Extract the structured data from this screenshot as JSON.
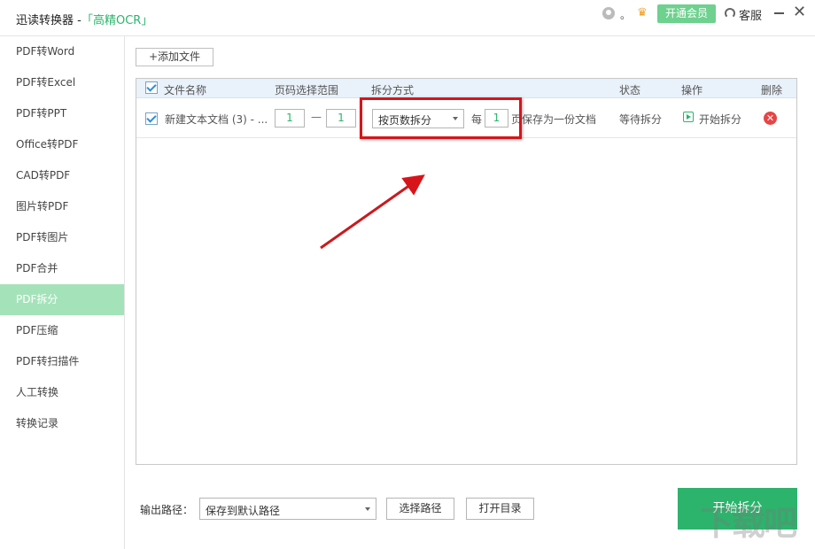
{
  "window": {
    "app_title": "迅读转换器 -",
    "ocr_link": "「高精OCR」",
    "user_name": "。",
    "vip_button": "开通会员",
    "service_label": "客服"
  },
  "sidebar": {
    "items": [
      {
        "label": "PDF转Word"
      },
      {
        "label": "PDF转Excel"
      },
      {
        "label": "PDF转PPT"
      },
      {
        "label": "Office转PDF"
      },
      {
        "label": "CAD转PDF"
      },
      {
        "label": "图片转PDF"
      },
      {
        "label": "PDF转图片"
      },
      {
        "label": "PDF合并"
      },
      {
        "label": "PDF拆分"
      },
      {
        "label": "PDF压缩"
      },
      {
        "label": "PDF转扫描件"
      },
      {
        "label": "人工转换"
      },
      {
        "label": "转换记录"
      }
    ],
    "active_index": 8
  },
  "toolbar": {
    "add_file": "+添加文件"
  },
  "table": {
    "headers": {
      "name": "文件名称",
      "page_range": "页码选择范围",
      "split_mode": "拆分方式",
      "status": "状态",
      "action": "操作",
      "delete": "删除"
    },
    "rows": [
      {
        "name": "新建文本文档 (3) - ...",
        "range_from": "1",
        "range_dash": "—",
        "range_to": "1",
        "split_mode": "按页数拆分",
        "every_label": "每",
        "pages_per": "1",
        "pages_suffix": "页保存为一份文档",
        "status": "等待拆分",
        "action": "开始拆分"
      }
    ]
  },
  "bottom": {
    "output_label": "输出路径：",
    "path_value": "保存到默认路径",
    "choose_path": "选择路径",
    "open_dir": "打开目录",
    "start_split": "开始拆分"
  },
  "watermark": "下载吧",
  "colors": {
    "accent": "#2cb46c",
    "sidebar_active": "#a4e3b9",
    "highlight": "#d7141a",
    "header_bg": "#e9f1fa"
  }
}
